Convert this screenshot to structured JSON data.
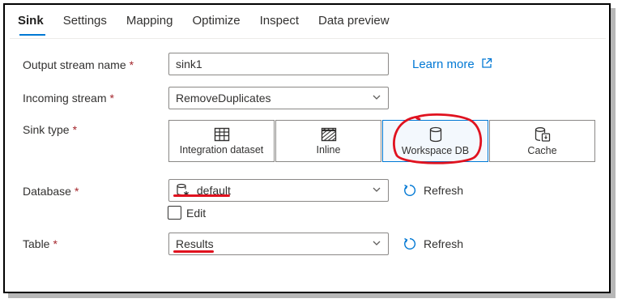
{
  "tabs": [
    {
      "label": "Sink",
      "active": true
    },
    {
      "label": "Settings",
      "active": false
    },
    {
      "label": "Mapping",
      "active": false
    },
    {
      "label": "Optimize",
      "active": false
    },
    {
      "label": "Inspect",
      "active": false
    },
    {
      "label": "Data preview",
      "active": false
    }
  ],
  "form": {
    "output_stream": {
      "label": "Output stream name",
      "required": "*",
      "value": "sink1",
      "link": "Learn more"
    },
    "incoming_stream": {
      "label": "Incoming stream",
      "required": "*",
      "value": "RemoveDuplicates"
    },
    "sink_type": {
      "label": "Sink type",
      "required": "*",
      "options": [
        {
          "label": "Integration dataset",
          "icon": "table-grid-icon"
        },
        {
          "label": "Inline",
          "icon": "hatched-box-icon"
        },
        {
          "label": "Workspace DB",
          "icon": "database-icon",
          "selected": true
        },
        {
          "label": "Cache",
          "icon": "cache-database-icon"
        }
      ]
    },
    "database": {
      "label": "Database",
      "required": "*",
      "value": "default",
      "edit_label": "Edit",
      "refresh_label": "Refresh"
    },
    "table": {
      "label": "Table",
      "required": "*",
      "value": "Results",
      "refresh_label": "Refresh"
    }
  },
  "colors": {
    "accent": "#0078d4",
    "annotation_red": "#e0121f",
    "required": "#a4262c"
  }
}
